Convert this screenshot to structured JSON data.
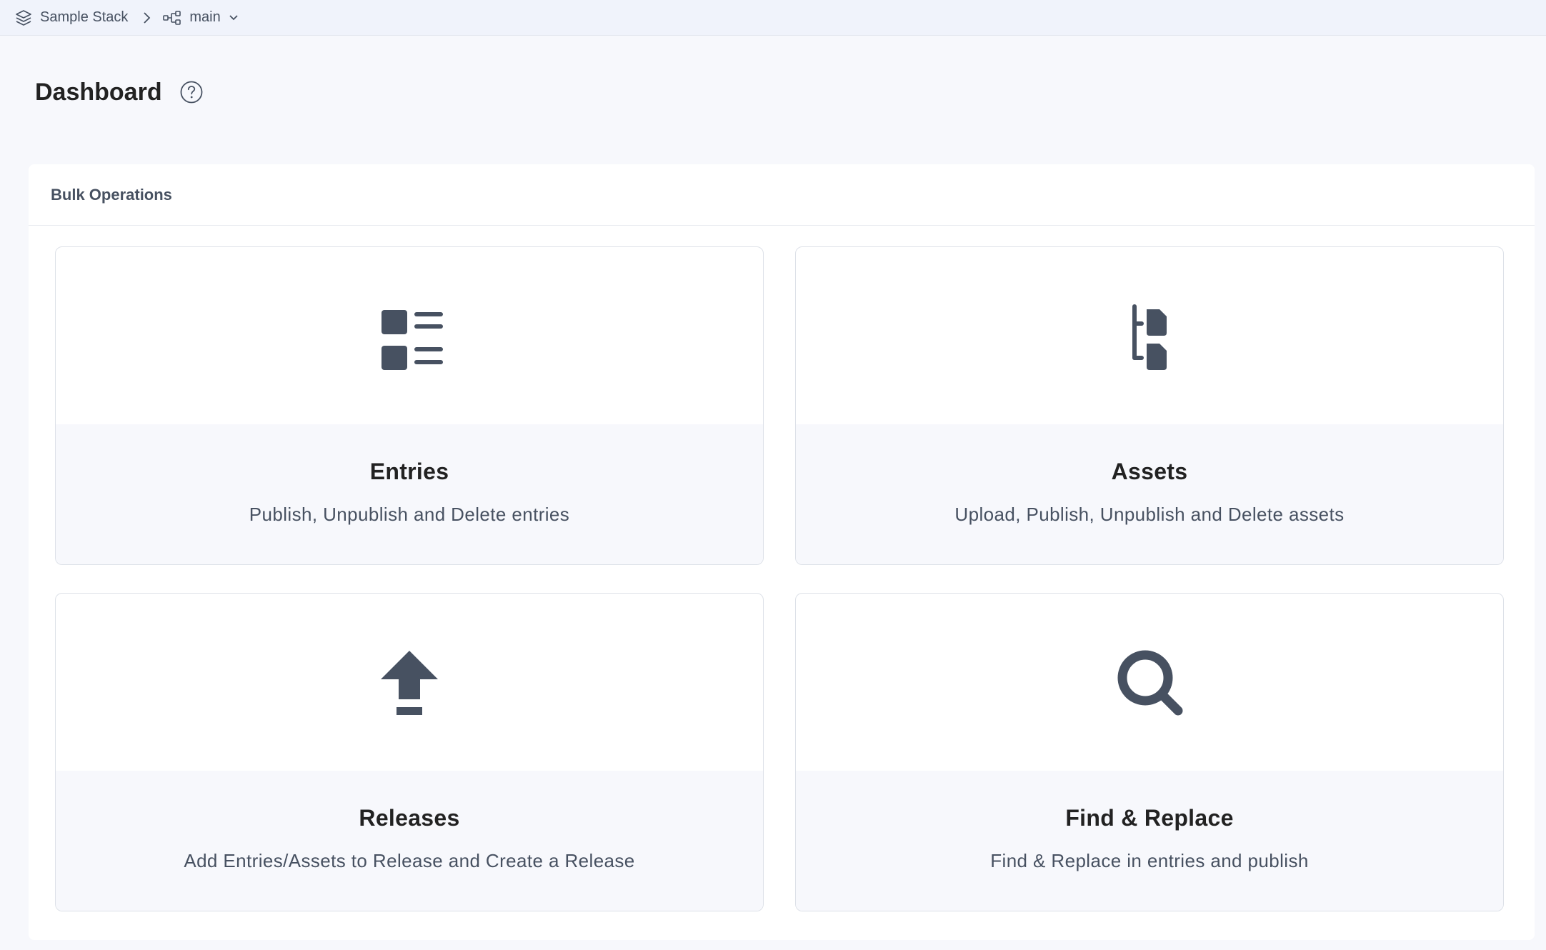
{
  "breadcrumb": {
    "stack_name": "Sample Stack",
    "branch_name": "main"
  },
  "page": {
    "title": "Dashboard"
  },
  "bulk_operations": {
    "title": "Bulk Operations",
    "cards": [
      {
        "title": "Entries",
        "description": "Publish, Unpublish and Delete entries",
        "icon": "entries-icon"
      },
      {
        "title": "Assets",
        "description": "Upload, Publish, Unpublish and Delete assets",
        "icon": "assets-icon"
      },
      {
        "title": "Releases",
        "description": "Add Entries/Assets to Release and Create a Release",
        "icon": "release-upload-icon"
      },
      {
        "title": "Find & Replace",
        "description": "Find & Replace in entries and publish",
        "icon": "search-icon"
      }
    ]
  },
  "colors": {
    "icon": "#475161",
    "title": "#222222",
    "background": "#f7f8fc"
  }
}
